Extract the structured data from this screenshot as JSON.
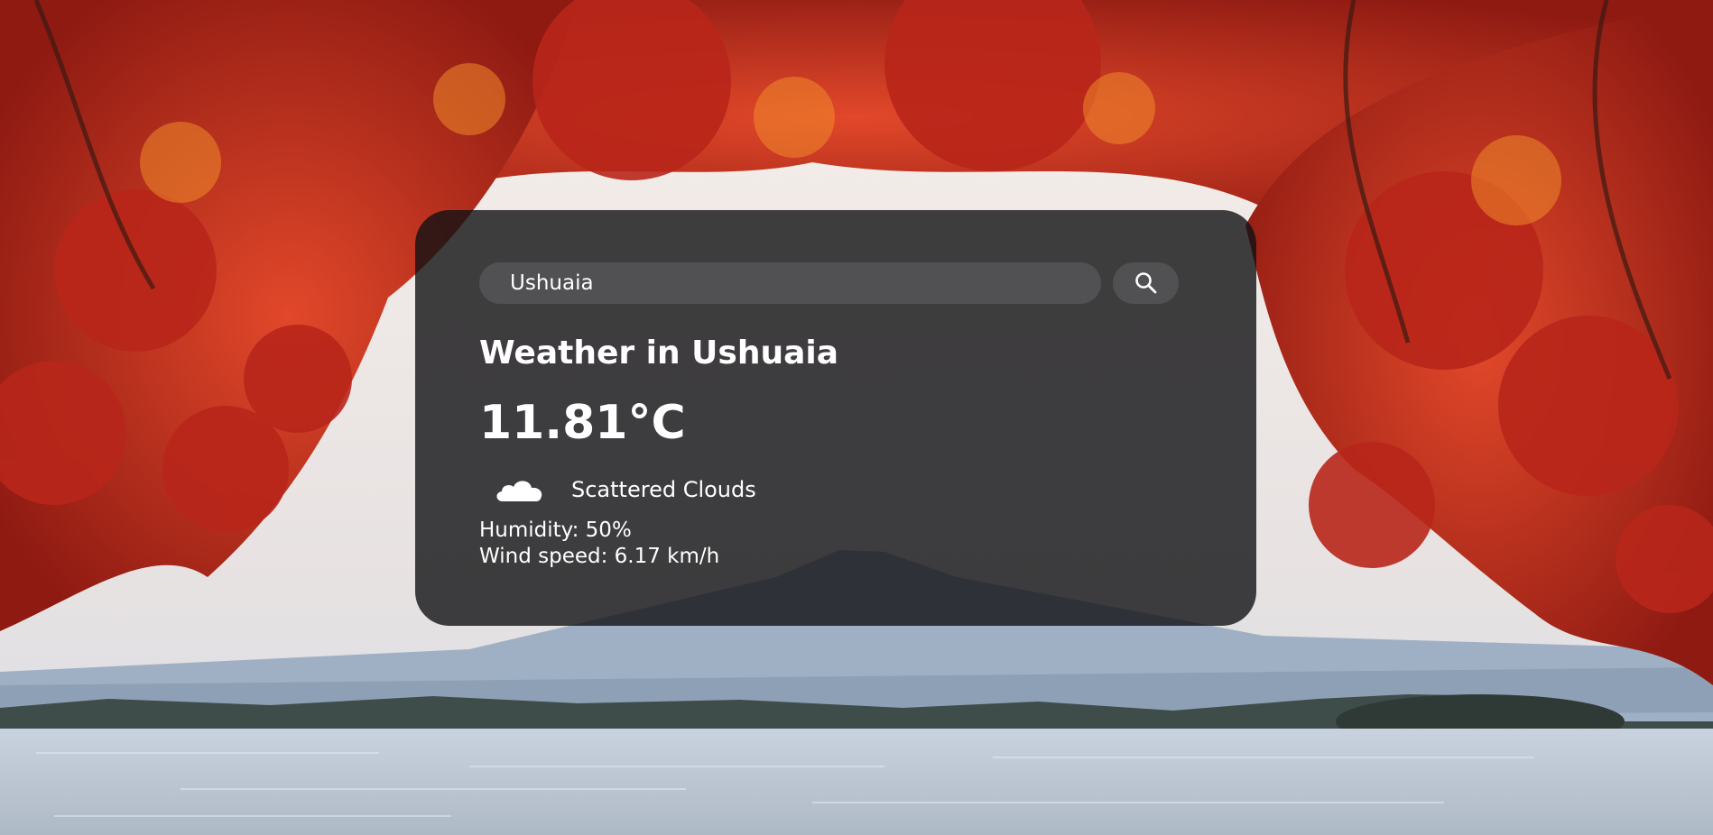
{
  "search": {
    "value": "Ushuaia",
    "button_icon": "search-icon"
  },
  "weather": {
    "title": "Weather in Ushuaia",
    "temperature": "11.81°C",
    "icon": "cloud-icon",
    "description": "Scattered Clouds",
    "humidity": "Humidity: 50%",
    "wind": "Wind speed: 6.17 km/h"
  },
  "colors": {
    "card_background": "#121214",
    "text": "#ffffff",
    "leaves": "#c6301c"
  }
}
